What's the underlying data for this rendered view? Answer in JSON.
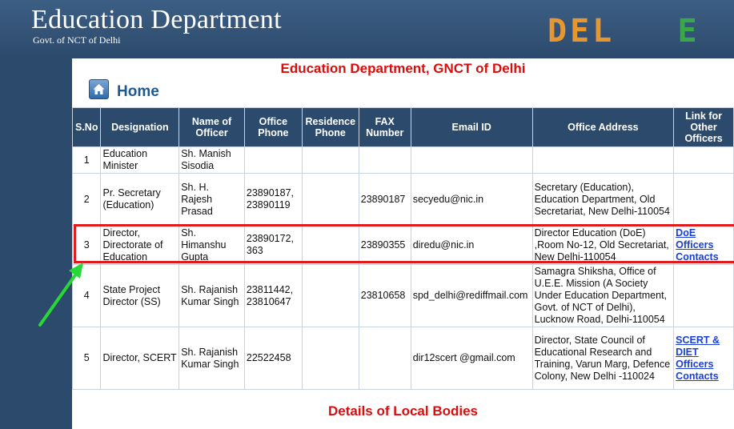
{
  "header": {
    "title": "Education Department",
    "subtitle": "Govt. of NCT of Delhi",
    "logo_part1": "DEL",
    "logo_part2": "E"
  },
  "page": {
    "heading": "Education Department, GNCT of Delhi",
    "home_label": "Home",
    "local_bodies_title": "Details of Local Bodies"
  },
  "table": {
    "headers": [
      "S.No",
      "Designation",
      "Name of Officer",
      "Office Phone",
      "Residence Phone",
      "FAX Number",
      "Email ID",
      "Office Address",
      "Link for Other Officers"
    ],
    "rows": [
      {
        "sno": "1",
        "designation": "Education Minister",
        "name": "Sh. Manish Sisodia",
        "office_phone": "",
        "residence_phone": "",
        "fax": "",
        "email": "",
        "address": "",
        "link": ""
      },
      {
        "sno": "2",
        "designation": "Pr. Secretary (Education)",
        "name": "Sh. H. Rajesh Prasad",
        "office_phone": "23890187, 23890119",
        "residence_phone": "",
        "fax": "23890187",
        "email": "secyedu@nic.in",
        "address": "Secretary (Education), Education Department, Old Secretariat, New Delhi-110054",
        "link": ""
      },
      {
        "sno": "3",
        "designation": "Director, Directorate of Education",
        "name": "Sh. Himanshu Gupta",
        "office_phone": "23890172, 363",
        "residence_phone": "",
        "fax": "23890355",
        "email": "diredu@nic.in",
        "address": "Director Education (DoE) ,Room No-12, Old Secretariat, New Delhi-110054",
        "link": "DoE Officers Contacts"
      },
      {
        "sno": "4",
        "designation": "State Project Director (SS)",
        "name": "Sh. Rajanish Kumar Singh",
        "office_phone": "23811442, 23810647",
        "residence_phone": "",
        "fax": "23810658",
        "email": "spd_delhi@rediffmail.com",
        "address": "Samagra Shiksha, Office of U.E.E. Mission (A Society Under Education Department, Govt. of NCT of Delhi), Lucknow Road, Delhi-110054",
        "link": ""
      },
      {
        "sno": "5",
        "designation": "Director, SCERT",
        "name": "Sh. Rajanish Kumar Singh",
        "office_phone": "22522458",
        "residence_phone": "",
        "fax": "",
        "email": "dir12scert @gmail.com",
        "address": "Director, State Council of Educational Research and Training, Varun Marg, Defence Colony, New Delhi -110024",
        "link": "SCERT & DIET Officers Contacts"
      }
    ]
  },
  "annotations": {
    "highlight_color": "#e01b1b",
    "arrow_color": "#27d837"
  },
  "icons": {
    "home": "home-icon",
    "arrow": "arrow-icon"
  },
  "colors": {
    "header_bg": "#2c4a6b",
    "heading_red": "#d80d0d",
    "link_blue": "#1a3fd6"
  }
}
